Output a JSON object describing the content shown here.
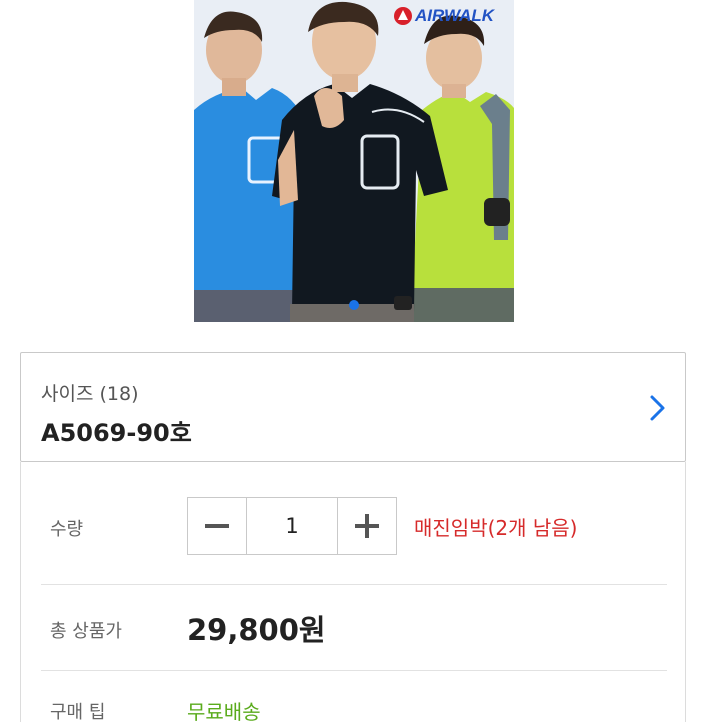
{
  "product_image": {
    "brand": "AIRWALK",
    "brand_color": "#2253c4",
    "logo_color": "#d8202a",
    "shirt_colors": [
      "#2a8de0",
      "#111820",
      "#b8e03c"
    ],
    "carousel_active_index": 0,
    "carousel_dot_color": "#1a73e8"
  },
  "option": {
    "label": "사이즈 (18)",
    "value": "A5069-90호",
    "chevron_icon": "chevron-right-icon",
    "chevron_color": "#1a73e8"
  },
  "quantity": {
    "label": "수량",
    "value": "1",
    "minus_icon": "minus-icon",
    "plus_icon": "plus-icon",
    "stock_warning": "매진임박(2개 남음)",
    "stock_warning_color": "#d62a2a"
  },
  "total": {
    "label": "총 상품가",
    "price": "29,800원"
  },
  "shipping": {
    "label": "구매 팁",
    "value": "무료배송",
    "value_color": "#5aab1c"
  }
}
